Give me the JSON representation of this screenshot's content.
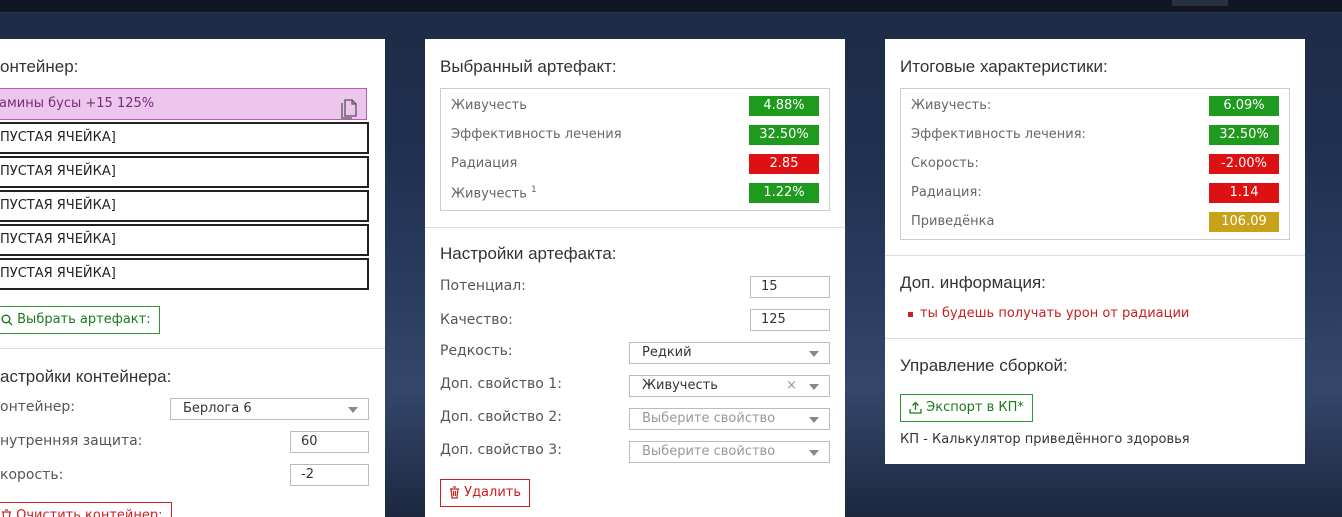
{
  "container": {
    "title": "онтейнер:",
    "slots": [
      "амины бусы +15 125%",
      "ПУСТАЯ ЯЧЕЙКА]",
      "ПУСТАЯ ЯЧЕЙКА]",
      "ПУСТАЯ ЯЧЕЙКА]",
      "ПУСТАЯ ЯЧЕЙКА]",
      "ПУСТАЯ ЯЧЕЙКА]"
    ],
    "select_artifact_label": "Выбрать артефакт:",
    "settings_title": "астройки контейнера:",
    "container_label": "онтейнер:",
    "container_value": "Берлога 6",
    "inner_protection_label": "нутренняя защита:",
    "inner_protection_value": "60",
    "speed_label": "корость:",
    "speed_value": "-2",
    "clear_label": "Очистить контейнер:"
  },
  "artifact": {
    "title": "Выбранный артефакт:",
    "stats": [
      {
        "name": "Живучесть",
        "sup": "",
        "value": "4.88%",
        "color": "#1e9a1e"
      },
      {
        "name": "Эффективность лечения",
        "sup": "",
        "value": "32.50%",
        "color": "#1e9a1e"
      },
      {
        "name": "Радиация",
        "sup": "",
        "value": "2.85",
        "color": "#dd1111"
      },
      {
        "name": "Живучесть",
        "sup": "1",
        "value": "1.22%",
        "color": "#1e9a1e"
      }
    ],
    "settings_title": "Настройки артефакта:",
    "potential_label": "Потенциал:",
    "potential_value": "15",
    "quality_label": "Качество:",
    "quality_value": "125",
    "rarity_label": "Редкость:",
    "rarity_value": "Редкий",
    "prop1_label": "Доп. свойство 1:",
    "prop1_value": "Живучесть",
    "prop2_label": "Доп. свойство 2:",
    "prop2_placeholder": "Выберите свойство",
    "prop3_label": "Доп. свойство 3:",
    "prop3_placeholder": "Выберите свойство",
    "delete_label": "Удалить"
  },
  "summary": {
    "title": "Итоговые характеристики:",
    "stats": [
      {
        "name": "Живучесть:",
        "value": "6.09%",
        "color": "#1e9a1e"
      },
      {
        "name": "Эффективность лечения:",
        "value": "32.50%",
        "color": "#1e9a1e"
      },
      {
        "name": "Скорость:",
        "value": "-2.00%",
        "color": "#dd1111"
      },
      {
        "name": "Радиация:",
        "value": "1.14",
        "color": "#dd1111"
      },
      {
        "name": "Приведёнка",
        "value": "106.09",
        "color": "#c8a21a"
      }
    ],
    "info_title": "Доп. информация:",
    "info_items": [
      "ты будешь получать урон от радиации"
    ],
    "build_title": "Управление сборкой:",
    "export_label": "Экспорт в КП*",
    "footnote": "КП - Калькулятор приведённого здоровья"
  }
}
